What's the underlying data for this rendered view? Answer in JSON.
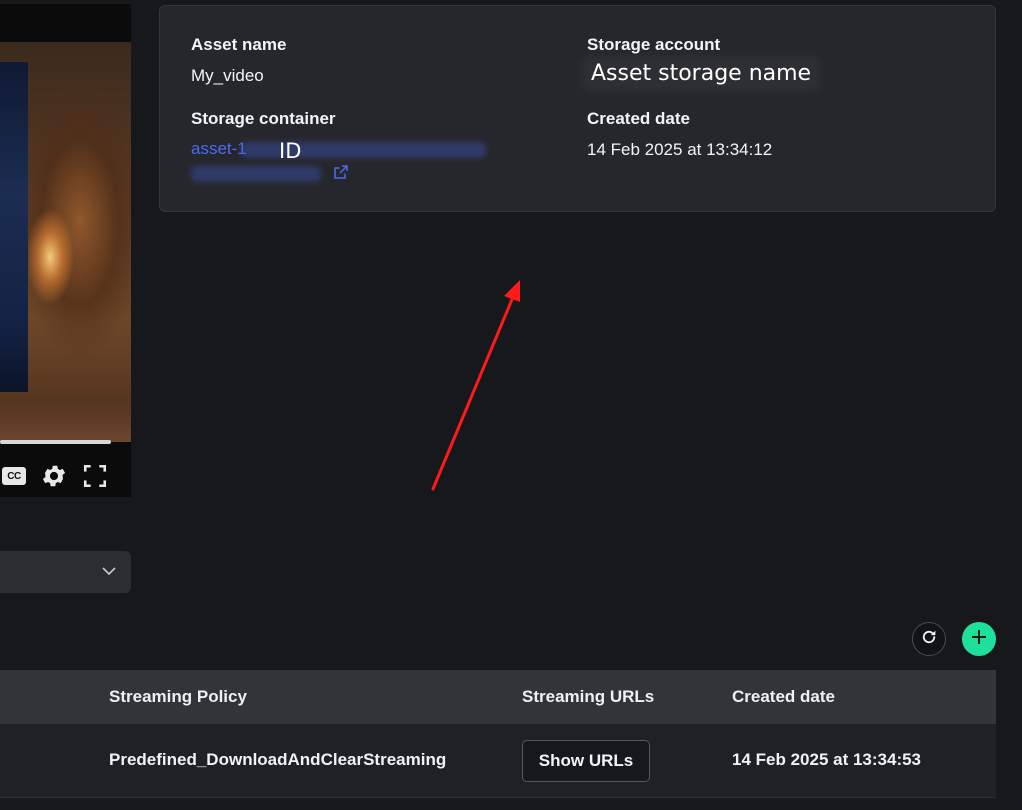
{
  "asset_details": {
    "asset_name_label": "Asset name",
    "asset_name_value": "My_video",
    "storage_account_label": "Storage account",
    "storage_account_value": "Asset storage name",
    "storage_container_label": "Storage container",
    "storage_container_link": "asset-1",
    "storage_container_id_overlay": "ID",
    "created_date_label": "Created date",
    "created_date_value": "14 Feb 2025 at 13:34:12"
  },
  "video_player": {
    "controls": [
      "cc-icon",
      "gear-icon",
      "fullscreen-icon"
    ],
    "cc_label": "CC"
  },
  "streaming_table": {
    "columns": [
      "Streaming Policy",
      "Streaming URLs",
      "Created date"
    ],
    "rows": [
      {
        "streaming_policy": "Predefined_DownloadAndClearStreaming",
        "streaming_urls_button": "Show URLs",
        "created_date": "14 Feb 2025 at 13:34:53"
      }
    ]
  },
  "actions": {
    "refresh_icon": "refresh-icon",
    "add_icon": "plus-icon"
  },
  "colors": {
    "background": "#17181c",
    "card": "#26272c",
    "link": "#4a6cf0",
    "accent_add": "#1fe09a",
    "annotation_arrow": "#ff1a1a"
  }
}
